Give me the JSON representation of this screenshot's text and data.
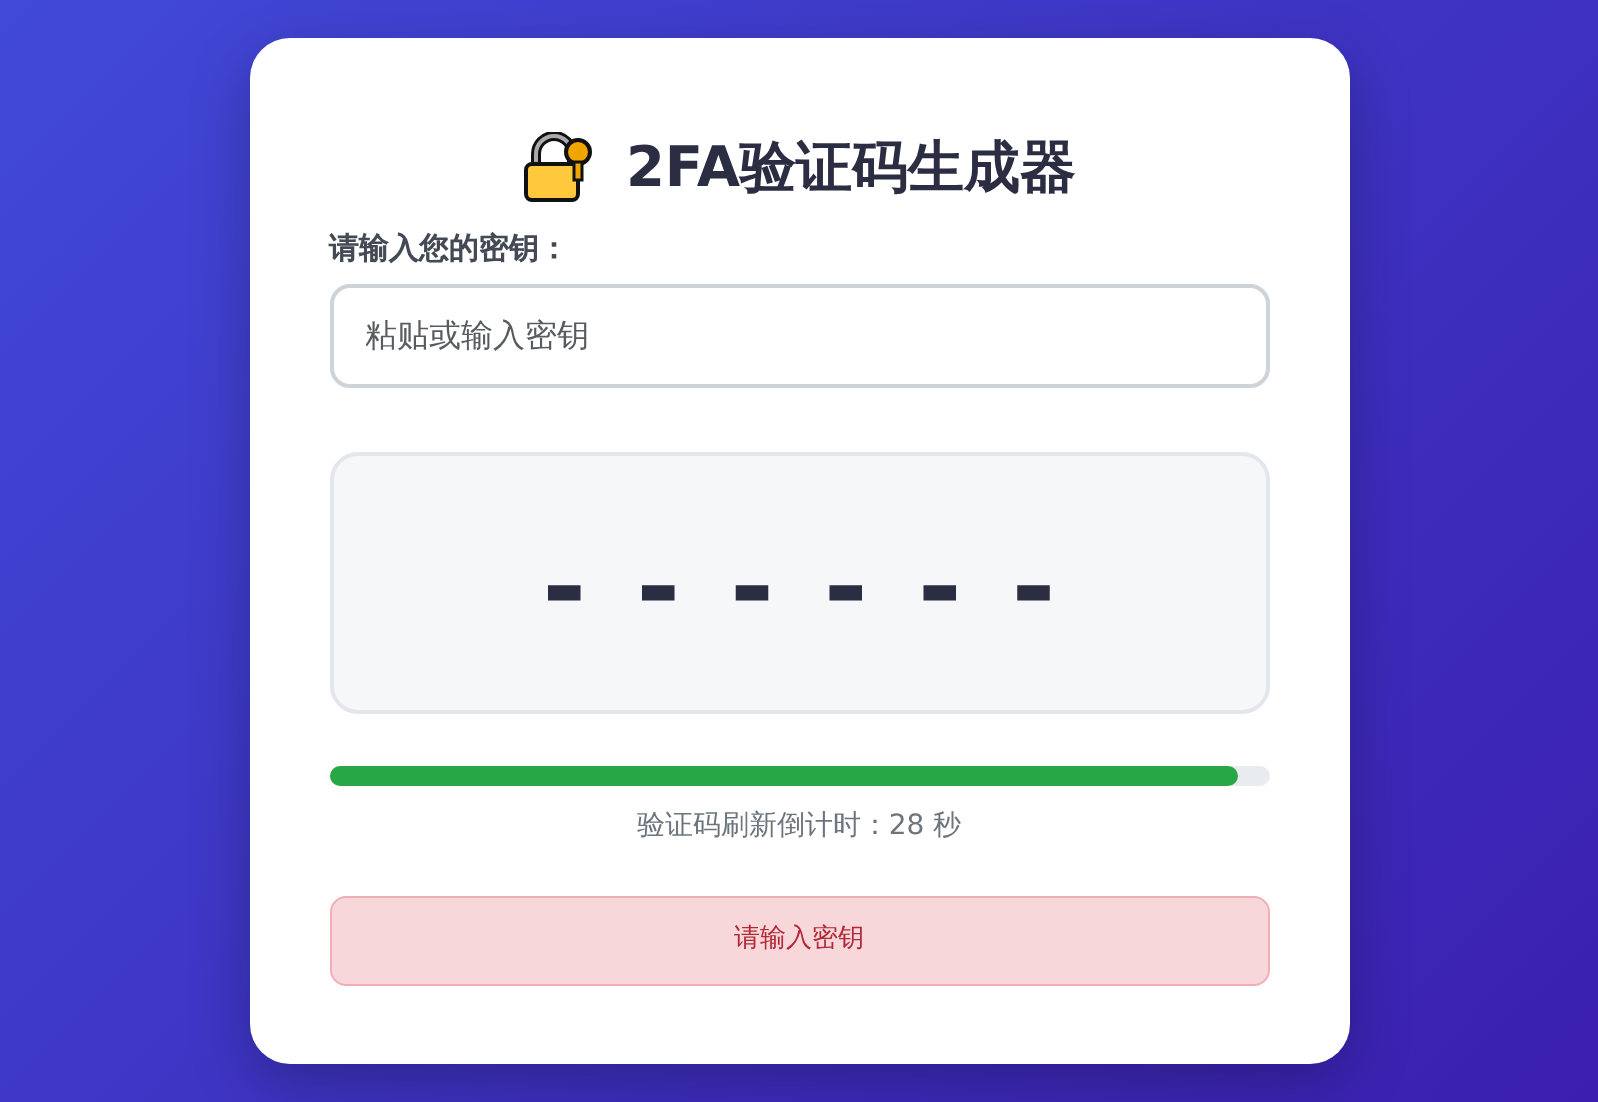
{
  "title": "2FA验证码生成器",
  "secret": {
    "label": "请输入您的密钥：",
    "placeholder": "粘贴或输入密钥"
  },
  "code": "------",
  "progress": {
    "level": 0.966
  },
  "countdown": "验证码刷新倒计时：28 秒",
  "alert": {
    "kind": "danger",
    "text": "请输入密钥"
  }
}
